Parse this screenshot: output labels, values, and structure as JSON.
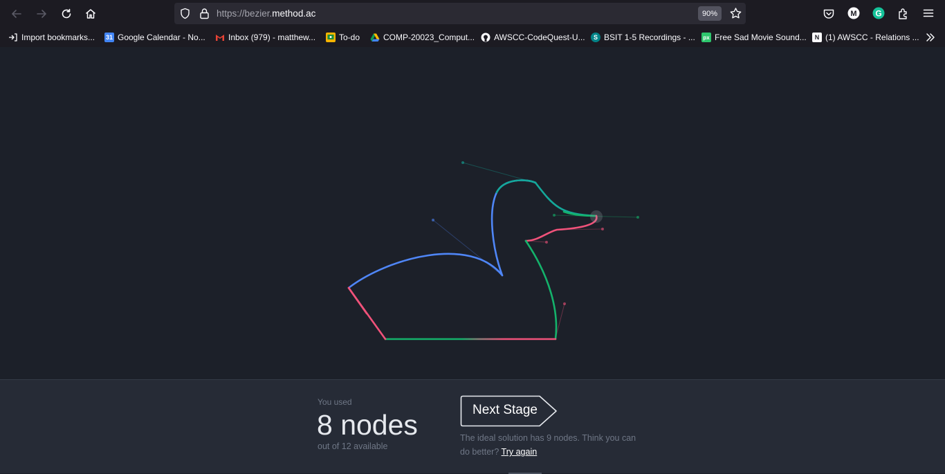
{
  "browser": {
    "url_prefix": "https://bezier.",
    "url_domain": "method.ac",
    "zoom": "90%",
    "bookmarks": [
      {
        "label": "Import bookmarks...",
        "icon": "import-icon"
      },
      {
        "label": "Google Calendar - No...",
        "icon": "google-calendar-icon"
      },
      {
        "label": "Inbox (979) - matthew...",
        "icon": "gmail-icon"
      },
      {
        "label": "To-do",
        "icon": "google-classroom-icon"
      },
      {
        "label": "COMP-20023_Comput...",
        "icon": "google-drive-icon"
      },
      {
        "label": "AWSCC-CodeQuest-U...",
        "icon": "github-icon"
      },
      {
        "label": "BSIT 1-5 Recordings - ...",
        "icon": "sharepoint-icon"
      },
      {
        "label": "Free Sad Movie Sound...",
        "icon": "pixabay-icon"
      },
      {
        "label": "(1) AWSCC - Relations ...",
        "icon": "notion-icon"
      }
    ],
    "colors": {
      "chrome": "#1c1b22",
      "urlbar": "#2b2a33"
    }
  },
  "game": {
    "you_used_label": "You used",
    "nodes_used": "8 nodes",
    "out_of": "out of 12 available",
    "next_stage_label": "Next Stage",
    "ideal_message": "The ideal solution has 9 nodes. Think you can do better?",
    "try_again_label": "Try again",
    "colors": {
      "background": "#1c2029",
      "panel": "#262b36",
      "curve_blue": "#4f86f7",
      "curve_teal": "#14a89a",
      "curve_green": "#14b26b",
      "curve_pink": "#f0527a"
    }
  }
}
